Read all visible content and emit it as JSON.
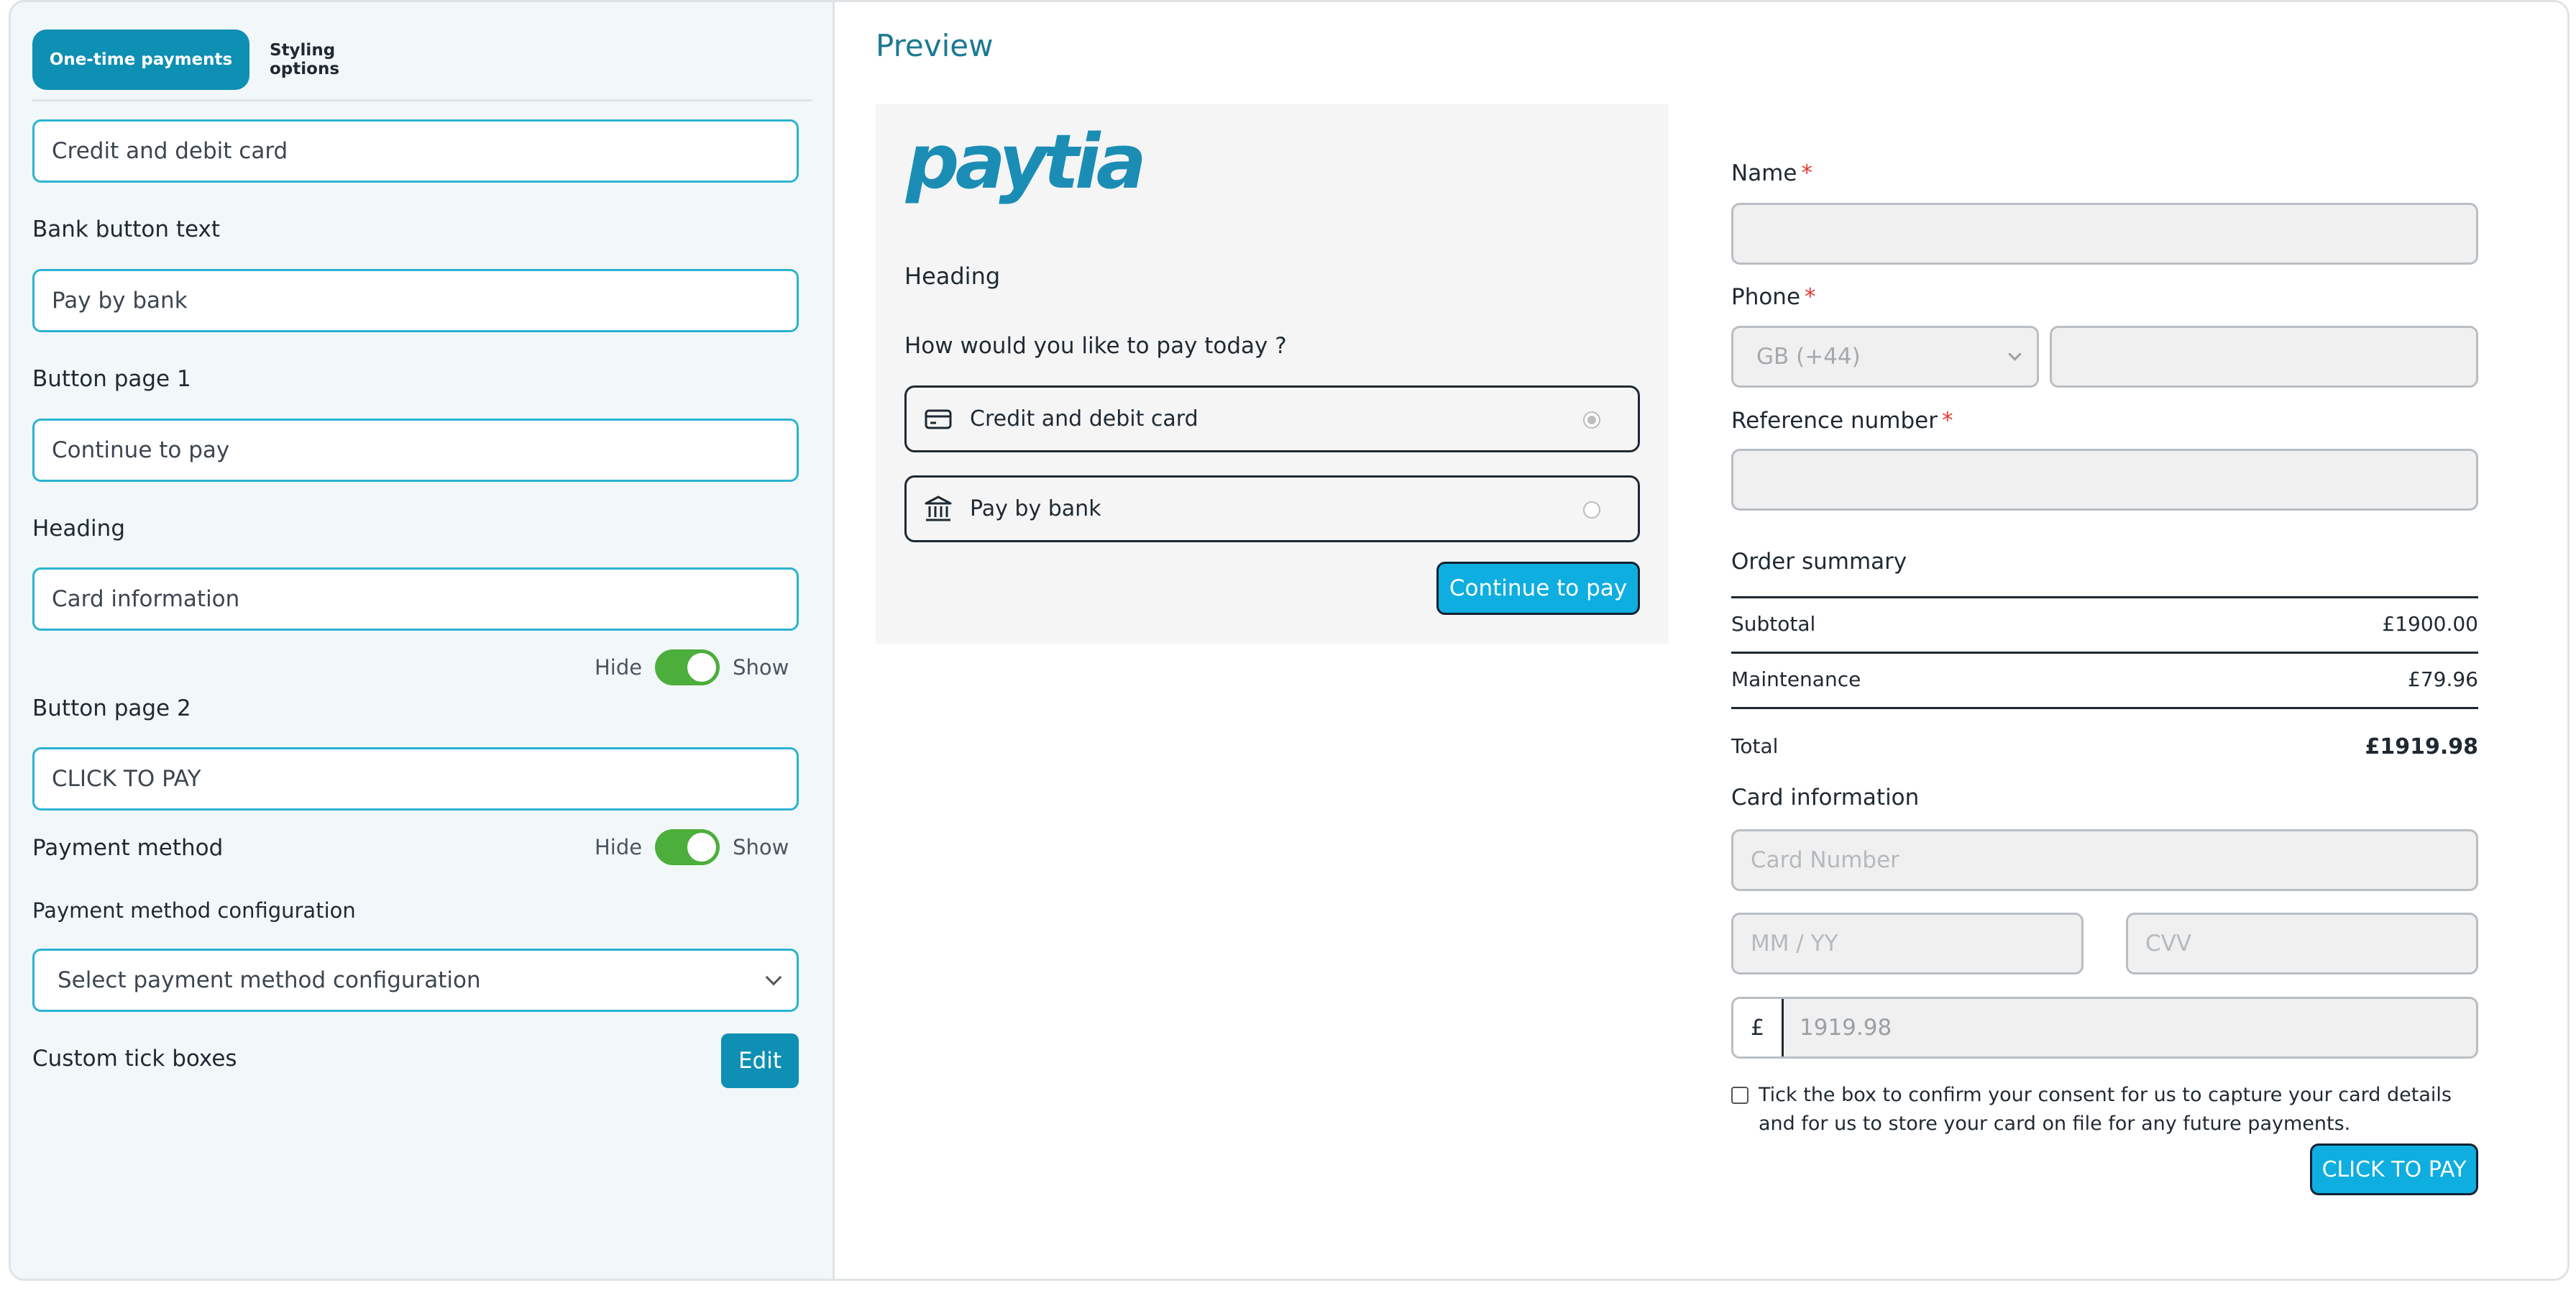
{
  "tabs": {
    "one_time": "One-time payments",
    "styling": "Styling options"
  },
  "editor": {
    "card_text_value": "Credit and debit card",
    "bank_button_label": "Bank button text",
    "bank_button_value": "Pay by bank",
    "button_page1_label": "Button page 1",
    "button_page1_value": "Continue to pay",
    "heading_label": "Heading",
    "heading_value": "Card information",
    "heading_toggle": {
      "hide": "Hide",
      "show": "Show",
      "state": "show"
    },
    "button_page2_label": "Button page 2",
    "button_page2_value": "CLICK TO PAY",
    "payment_method_label": "Payment method",
    "payment_method_toggle": {
      "hide": "Hide",
      "show": "Show",
      "state": "show"
    },
    "config_label": "Payment method configuration",
    "config_placeholder": "Select payment method configuration",
    "custom_tick_label": "Custom tick boxes",
    "edit_button": "Edit"
  },
  "preview": {
    "title": "Preview",
    "logo_text": "paytia",
    "heading": "Heading",
    "question": "How would you like to pay today ?",
    "options": [
      {
        "label": "Credit and debit card",
        "icon": "credit-card-icon",
        "selected": true
      },
      {
        "label": "Pay by bank",
        "icon": "bank-icon",
        "selected": false
      }
    ],
    "continue_button": "Continue to pay"
  },
  "form": {
    "name_label": "Name",
    "phone_label": "Phone",
    "phone_country": "GB (+44)",
    "reference_label": "Reference number",
    "required_mark": "*",
    "order_summary": "Order summary",
    "rows": [
      {
        "label": "Subtotal",
        "value": "£1900.00"
      },
      {
        "label": "Maintenance",
        "value": "£79.96"
      }
    ],
    "total": {
      "label": "Total",
      "value": "£1919.98"
    },
    "card_info": "Card information",
    "card_number_placeholder": "Card Number",
    "expiry_placeholder": "MM / YY",
    "cvv_placeholder": "CVV",
    "currency_symbol": "£",
    "amount_value": "1919.98",
    "consent_text": "Tick the box to confirm your consent for us to capture your card details and for us to store your card on file for any future payments.",
    "pay_button": "CLICK TO PAY"
  },
  "colors": {
    "accent": "#0e8fb4",
    "button": "#0eaee0",
    "toggle_on": "#4cae3b",
    "required": "#e53935",
    "logo": "#1b8db5"
  }
}
